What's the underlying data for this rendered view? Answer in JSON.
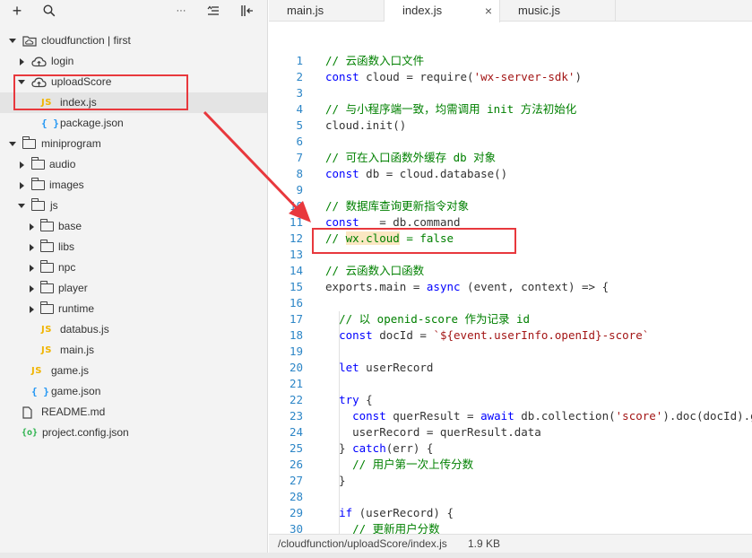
{
  "sidebar": {
    "toolbar": {
      "add": "+",
      "search": "⚲",
      "more": "···",
      "sort": "≡",
      "collapse": "|←"
    },
    "tree": [
      {
        "label": "cloudfunction | first",
        "icon": "cloud-folder-icon",
        "expanded": true
      },
      {
        "label": "login",
        "icon": "cloud-icon",
        "expanded": false
      },
      {
        "label": "uploadScore",
        "icon": "cloud-icon",
        "expanded": true
      },
      {
        "label": "index.js",
        "icon": "js-file-icon",
        "badge": "JS",
        "selected": true
      },
      {
        "label": "package.json",
        "icon": "json-file-icon",
        "badge": "{ }"
      },
      {
        "label": "miniprogram",
        "icon": "folder-icon",
        "expanded": true
      },
      {
        "label": "audio",
        "icon": "folder-icon",
        "expanded": false
      },
      {
        "label": "images",
        "icon": "folder-icon",
        "expanded": false
      },
      {
        "label": "js",
        "icon": "folder-icon",
        "expanded": true
      },
      {
        "label": "base",
        "icon": "folder-icon",
        "expanded": false
      },
      {
        "label": "libs",
        "icon": "folder-icon",
        "expanded": false
      },
      {
        "label": "npc",
        "icon": "folder-icon",
        "expanded": false
      },
      {
        "label": "player",
        "icon": "folder-icon",
        "expanded": false
      },
      {
        "label": "runtime",
        "icon": "folder-icon",
        "expanded": false
      },
      {
        "label": "databus.js",
        "icon": "js-file-icon",
        "badge": "JS"
      },
      {
        "label": "main.js",
        "icon": "js-file-icon",
        "badge": "JS"
      },
      {
        "label": "game.js",
        "icon": "js-file-icon",
        "badge": "JS"
      },
      {
        "label": "game.json",
        "icon": "json-file-icon",
        "badge": "{ }"
      },
      {
        "label": "README.md",
        "icon": "file-icon"
      },
      {
        "label": "project.config.json",
        "icon": "config-file-icon",
        "badge": "{o}"
      }
    ]
  },
  "tabs": [
    {
      "label": "main.js",
      "active": false
    },
    {
      "label": "index.js",
      "active": true,
      "close": "×"
    },
    {
      "label": "music.js",
      "active": false
    }
  ],
  "code": {
    "line_numbers": [
      "1",
      "2",
      "3",
      "4",
      "5",
      "6",
      "7",
      "8",
      "9",
      "10",
      "11",
      "12",
      "13",
      "14",
      "15",
      "16",
      "17",
      "18",
      "19",
      "20",
      "21",
      "22",
      "23",
      "24",
      "25",
      "26",
      "27",
      "28",
      "29",
      "30"
    ],
    "lines": [
      "// 云函数入口文件",
      "const cloud = require('wx-server-sdk')",
      "",
      "// 与小程序端一致，均需调用 init 方法初始化",
      "cloud.init()",
      "",
      "// 可在入口函数外缓存 db 对象",
      "const db = cloud.database()",
      "",
      "// 数据库查询更新指令对象",
      "const _ = db.command",
      "// wx.cloud = false",
      "",
      "// 云函数入口函数",
      "exports.main = async (event, context) => {",
      "",
      "  // 以 openid-score 作为记录 id",
      "  const docId = `${event.userInfo.openId}-score`",
      "",
      "  let userRecord",
      "",
      "  try {",
      "    const querResult = await db.collection('score').doc(docId).get()",
      "    userRecord = querResult.data",
      "  } catch(err) {",
      "    // 用户第一次上传分数",
      "  }",
      "",
      "  if (userRecord) {",
      "    // 更新用户分数"
    ]
  },
  "status": {
    "path": "/cloudfunction/uploadScore/index.js",
    "size": "1.9 KB"
  },
  "colors": {
    "comment": "#008000",
    "keyword": "#0000ff",
    "string": "#a31515",
    "line_number": "#2d86c7",
    "annotation": "#e8383d"
  }
}
